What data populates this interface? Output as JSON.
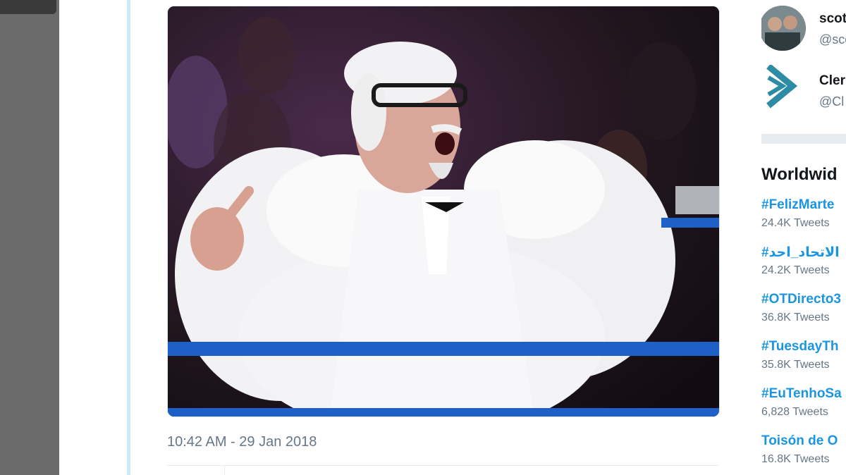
{
  "tweet": {
    "timestamp": "10:42 AM - 29 Jan 2018",
    "media_alt": ""
  },
  "sidebar": {
    "follow_suggestions": [
      {
        "name": "scot",
        "handle": "@sco"
      },
      {
        "name": "Cler",
        "handle": "@Cl"
      }
    ],
    "trends_title": "Worldwid",
    "trends": [
      {
        "name": "#FelizMarte",
        "count": "24.4K Tweets"
      },
      {
        "name": "#الاتحاد_احد",
        "count": "24.2K Tweets"
      },
      {
        "name": "#OTDirecto3",
        "count": "36.8K Tweets"
      },
      {
        "name": "#TuesdayTh",
        "count": "35.8K Tweets"
      },
      {
        "name": "#EuTenhoSa",
        "count": "6,828 Tweets"
      },
      {
        "name": "Toisón de O",
        "count": "16.8K Tweets"
      }
    ]
  },
  "colors": {
    "link": "#1b95e0",
    "muted": "#657786",
    "ring_rope": "#1f5fc8"
  },
  "icons": [
    "play-arrow-logo-icon"
  ]
}
